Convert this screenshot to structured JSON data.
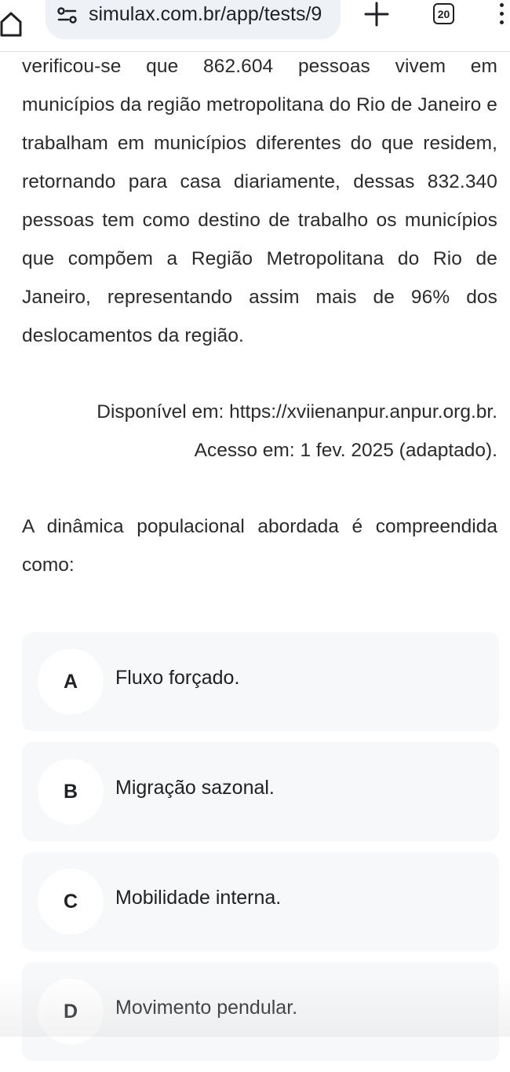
{
  "browser": {
    "url": "simulax.com.br/app/tests/9",
    "tab_count": "20",
    "icons": {
      "home": "home-icon",
      "site_settings": "tune-icon",
      "new_tab": "plus-icon",
      "menu": "more-vert-icon"
    }
  },
  "passage": {
    "text": "verificou-se que 862.604 pessoas vivem em municípios da região metropolitana do Rio de Janeiro e trabalham em municípios diferentes do que residem, retornando para casa diariamente, dessas 832.340 pessoas tem como destino de trabalho os municípios que compõem a Região Metropolitana do Rio de Janeiro, representando assim mais de 96% dos deslocamentos da região.",
    "source_line1": "Disponível em: https://xviienanpur.anpur.org.br.",
    "source_line2": "Acesso em: 1 fev. 2025 (adaptado)."
  },
  "question": {
    "text": "A dinâmica populacional abordada é compreendida como:"
  },
  "options": [
    {
      "letter": "A",
      "text": "Fluxo forçado."
    },
    {
      "letter": "B",
      "text": "Migração sazonal."
    },
    {
      "letter": "C",
      "text": "Mobilidade interna."
    },
    {
      "letter": "D",
      "text": "Movimento pendular."
    }
  ]
}
